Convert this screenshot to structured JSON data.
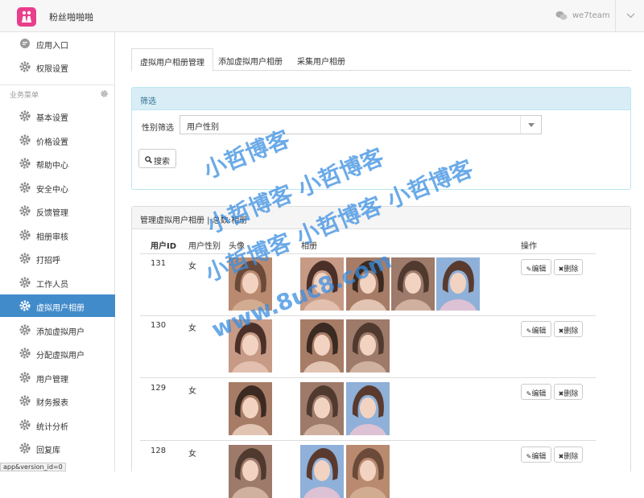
{
  "header": {
    "app_title": "粉丝啪啪啪",
    "team": "we7team"
  },
  "sidebar": {
    "top_items": [
      {
        "label": "应用入口",
        "icon": "chat-icon"
      },
      {
        "label": "权限设置",
        "icon": "gear-icon"
      }
    ],
    "section_label": "业务菜单",
    "items": [
      {
        "label": "基本设置"
      },
      {
        "label": "价格设置"
      },
      {
        "label": "帮助中心"
      },
      {
        "label": "安全中心"
      },
      {
        "label": "反馈管理"
      },
      {
        "label": "相册审核"
      },
      {
        "label": "打招呼"
      },
      {
        "label": "工作人员"
      },
      {
        "label": "虚拟用户相册",
        "active": true
      },
      {
        "label": "添加虚拟用户"
      },
      {
        "label": "分配虚拟用户"
      },
      {
        "label": "用户管理"
      },
      {
        "label": "财务报表"
      },
      {
        "label": "统计分析"
      },
      {
        "label": "回复库"
      }
    ]
  },
  "tabs": [
    {
      "label": "虚拟用户相册管理",
      "active": true
    },
    {
      "label": "添加虚拟用户相册"
    },
    {
      "label": "采集用户相册"
    }
  ],
  "filter": {
    "title": "筛选",
    "gender_label": "性别筛选",
    "gender_value": "用户性别",
    "search_label": "搜索"
  },
  "list": {
    "title": "管理虚拟用户相册 | 总数:相册",
    "columns": [
      "用户ID",
      "用户性别",
      "头像",
      "相册",
      "操作"
    ],
    "rows": [
      {
        "id": "131",
        "gender": "女",
        "album_count": 4
      },
      {
        "id": "130",
        "gender": "女",
        "album_count": 2
      },
      {
        "id": "129",
        "gender": "女",
        "album_count": 2
      },
      {
        "id": "128",
        "gender": "女",
        "album_count": 2
      }
    ],
    "edit_label": "编辑",
    "delete_label": "删除"
  },
  "watermark": {
    "line1": "小哲博客",
    "line2": "小哲博客 小哲博客",
    "line3": "小哲博客 小哲博客 小哲博客",
    "line4": "www.8uc8.com"
  },
  "status_url": "app&version_id=0",
  "colors": {
    "accent": "#428bca",
    "logo": "#e83e8c",
    "filter_head": "#d9edf7",
    "watermark": "#3a8ee0"
  }
}
